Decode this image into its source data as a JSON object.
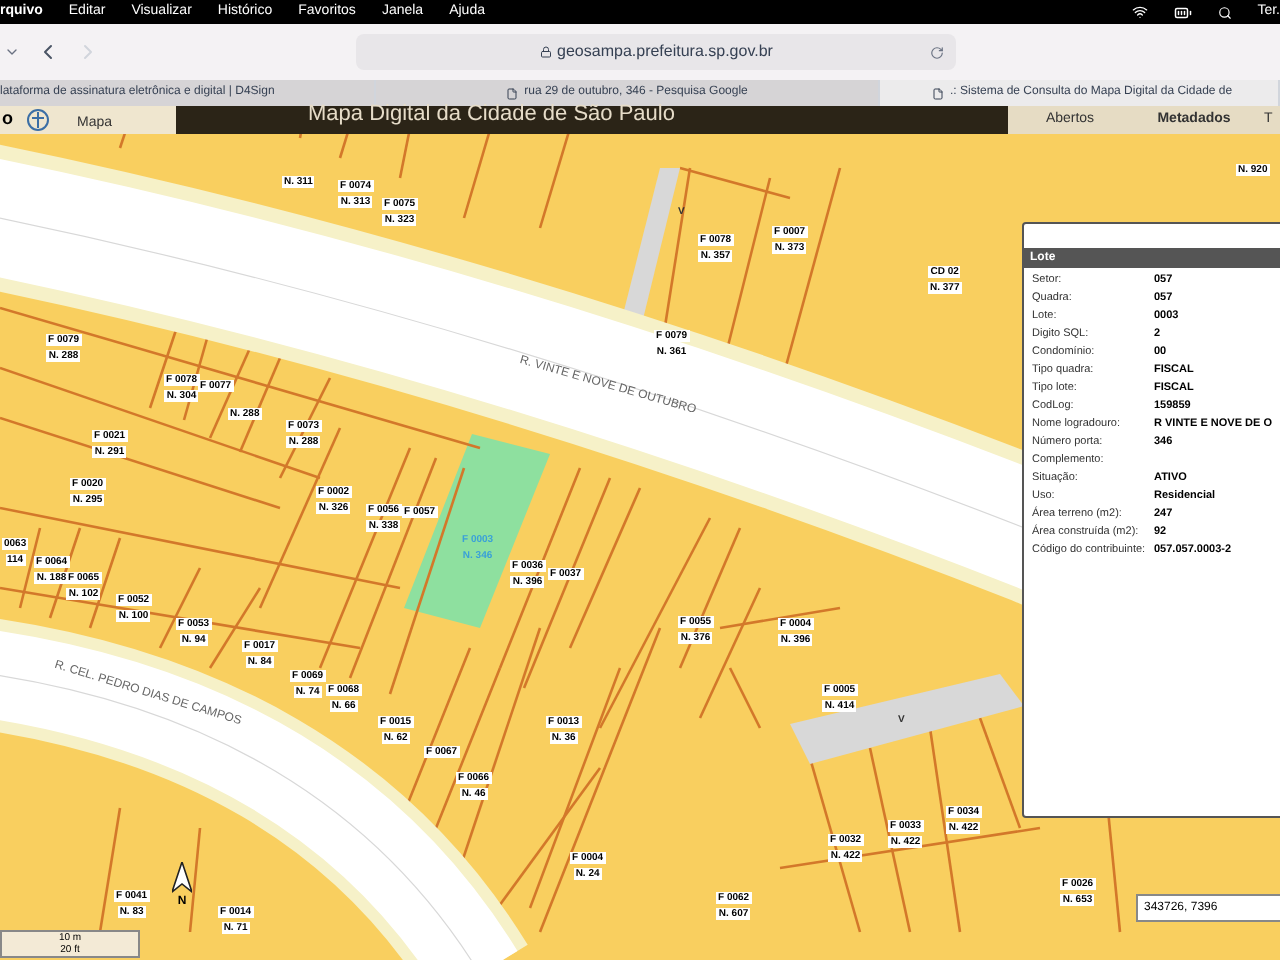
{
  "menu_bar": {
    "items": [
      "rquivo",
      "Editar",
      "Visualizar",
      "Histórico",
      "Favoritos",
      "Janela",
      "Ajuda"
    ],
    "clock": "Ter."
  },
  "browser": {
    "url": "geosampa.prefeitura.sp.gov.br",
    "tabs": [
      {
        "title": "lataforma de assinatura eletrônica e digital | D4Sign",
        "selected": false
      },
      {
        "title": "rua 29 de outubro, 346 - Pesquisa Google",
        "selected": false
      },
      {
        "title": ".: Sistema de Consulta do Mapa Digital da Cidade de",
        "selected": true
      }
    ]
  },
  "app_header": {
    "left_text": "o",
    "logo_caption": "Mapa",
    "title": "Mapa Digital da Cidade de São Paulo",
    "tabs": [
      {
        "label": "Abertos",
        "selected": false
      },
      {
        "label": "Metadados",
        "selected": true
      },
      {
        "label": "T",
        "selected": false
      }
    ]
  },
  "map": {
    "streets": [
      "R. VINTE E NOVE DE OUTUBRO",
      "R. CEL. PEDRO DIAS DE CAMPOS"
    ],
    "markers": [
      "V",
      "V"
    ],
    "lots": [
      {
        "lines": [
          "N. 311"
        ],
        "selected": false
      },
      {
        "lines": [
          "F 0074",
          "N. 313"
        ],
        "selected": false
      },
      {
        "lines": [
          "F 0075",
          "N. 323"
        ],
        "selected": false
      },
      {
        "lines": [
          "F 0079",
          "N. 288"
        ],
        "selected": false
      },
      {
        "lines": [
          "F 0078",
          "N. 304"
        ],
        "selected": false
      },
      {
        "lines": [
          "F 0077"
        ],
        "selected": false
      },
      {
        "lines": [
          "N. 288"
        ],
        "selected": false
      },
      {
        "lines": [
          "F 0073",
          "N. 288"
        ],
        "selected": false
      },
      {
        "lines": [
          "F 0021",
          "N. 291"
        ],
        "selected": false
      },
      {
        "lines": [
          "F 0020",
          "N. 295"
        ],
        "selected": false
      },
      {
        "lines": [
          "F 0002",
          "N. 326"
        ],
        "selected": false
      },
      {
        "lines": [
          "F 0056",
          "N. 338"
        ],
        "selected": false
      },
      {
        "lines": [
          "F 0057"
        ],
        "selected": false
      },
      {
        "lines": [
          "F 0003",
          "N. 346"
        ],
        "selected": true
      },
      {
        "lines": [
          "F 0036",
          "N. 396"
        ],
        "selected": false
      },
      {
        "lines": [
          "F 0037"
        ],
        "selected": false
      },
      {
        "lines": [
          "0063",
          "114"
        ],
        "selected": false
      },
      {
        "lines": [
          "F 0064",
          "N. 188"
        ],
        "selected": false
      },
      {
        "lines": [
          "F 0065",
          "N. 102"
        ],
        "selected": false
      },
      {
        "lines": [
          "F 0052",
          "N. 100"
        ],
        "selected": false
      },
      {
        "lines": [
          "F 0053",
          "N. 94"
        ],
        "selected": false
      },
      {
        "lines": [
          "F 0017",
          "N. 84"
        ],
        "selected": false
      },
      {
        "lines": [
          "F 0069",
          "N. 74"
        ],
        "selected": false
      },
      {
        "lines": [
          "F 0068",
          "N. 66"
        ],
        "selected": false
      },
      {
        "lines": [
          "F 0015",
          "N. 62"
        ],
        "selected": false
      },
      {
        "lines": [
          "F 0067"
        ],
        "selected": false
      },
      {
        "lines": [
          "F 0066",
          "N. 46"
        ],
        "selected": false
      },
      {
        "lines": [
          "F 0013",
          "N. 36"
        ],
        "selected": false
      },
      {
        "lines": [
          "F 0004",
          "N. 24"
        ],
        "selected": false
      },
      {
        "lines": [
          "F 0041",
          "N. 83"
        ],
        "selected": false
      },
      {
        "lines": [
          "F 0014",
          "N. 71"
        ],
        "selected": false
      },
      {
        "lines": [
          "F 0055",
          "N. 376"
        ],
        "selected": false
      },
      {
        "lines": [
          "F 0004",
          "N. 396"
        ],
        "selected": false
      },
      {
        "lines": [
          "F 0005",
          "N. 414"
        ],
        "selected": false
      },
      {
        "lines": [
          "F 0032",
          "N. 422"
        ],
        "selected": false
      },
      {
        "lines": [
          "F 0033",
          "N. 422"
        ],
        "selected": false
      },
      {
        "lines": [
          "F 0034",
          "N. 422"
        ],
        "selected": false
      },
      {
        "lines": [
          "F 0062",
          "N. 607"
        ],
        "selected": false
      },
      {
        "lines": [
          "F 0026",
          "N. 653"
        ],
        "selected": false
      },
      {
        "lines": [
          "F 0078",
          "N. 357"
        ],
        "selected": false
      },
      {
        "lines": [
          "F 0007",
          "N. 373"
        ],
        "selected": false
      },
      {
        "lines": [
          "CD 02",
          "N. 377"
        ],
        "selected": false
      },
      {
        "lines": [
          "F 0079",
          "N. 361"
        ],
        "selected": false
      },
      {
        "lines": [
          "N. 920"
        ],
        "selected": false
      }
    ],
    "scale": {
      "metric": "10 m",
      "imperial": "20 ft"
    },
    "north": "N",
    "coordinates": "343726, 7396"
  },
  "info_panel": {
    "title": "Lote",
    "rows": [
      {
        "label": "Setor:",
        "value": "057"
      },
      {
        "label": "Quadra:",
        "value": "057"
      },
      {
        "label": "Lote:",
        "value": "0003"
      },
      {
        "label": "Digito SQL:",
        "value": "2"
      },
      {
        "label": "Condomínio:",
        "value": "00"
      },
      {
        "label": "Tipo quadra:",
        "value": "FISCAL"
      },
      {
        "label": "Tipo lote:",
        "value": "FISCAL"
      },
      {
        "label": "CodLog:",
        "value": "159859"
      },
      {
        "label": "Nome logradouro:",
        "value": "R VINTE E NOVE DE O"
      },
      {
        "label": "Número porta:",
        "value": "346"
      },
      {
        "label": "Complemento:"
      },
      {
        "label": "Situação:",
        "value": "ATIVO"
      },
      {
        "label": "Uso:",
        "value": "Residencial"
      },
      {
        "label": "Área terreno (m2):",
        "value": "247"
      },
      {
        "label": "Área construída (m2):",
        "value": "92"
      },
      {
        "label": "Código do contribuinte:",
        "value": "057.057.0003-2"
      }
    ]
  }
}
